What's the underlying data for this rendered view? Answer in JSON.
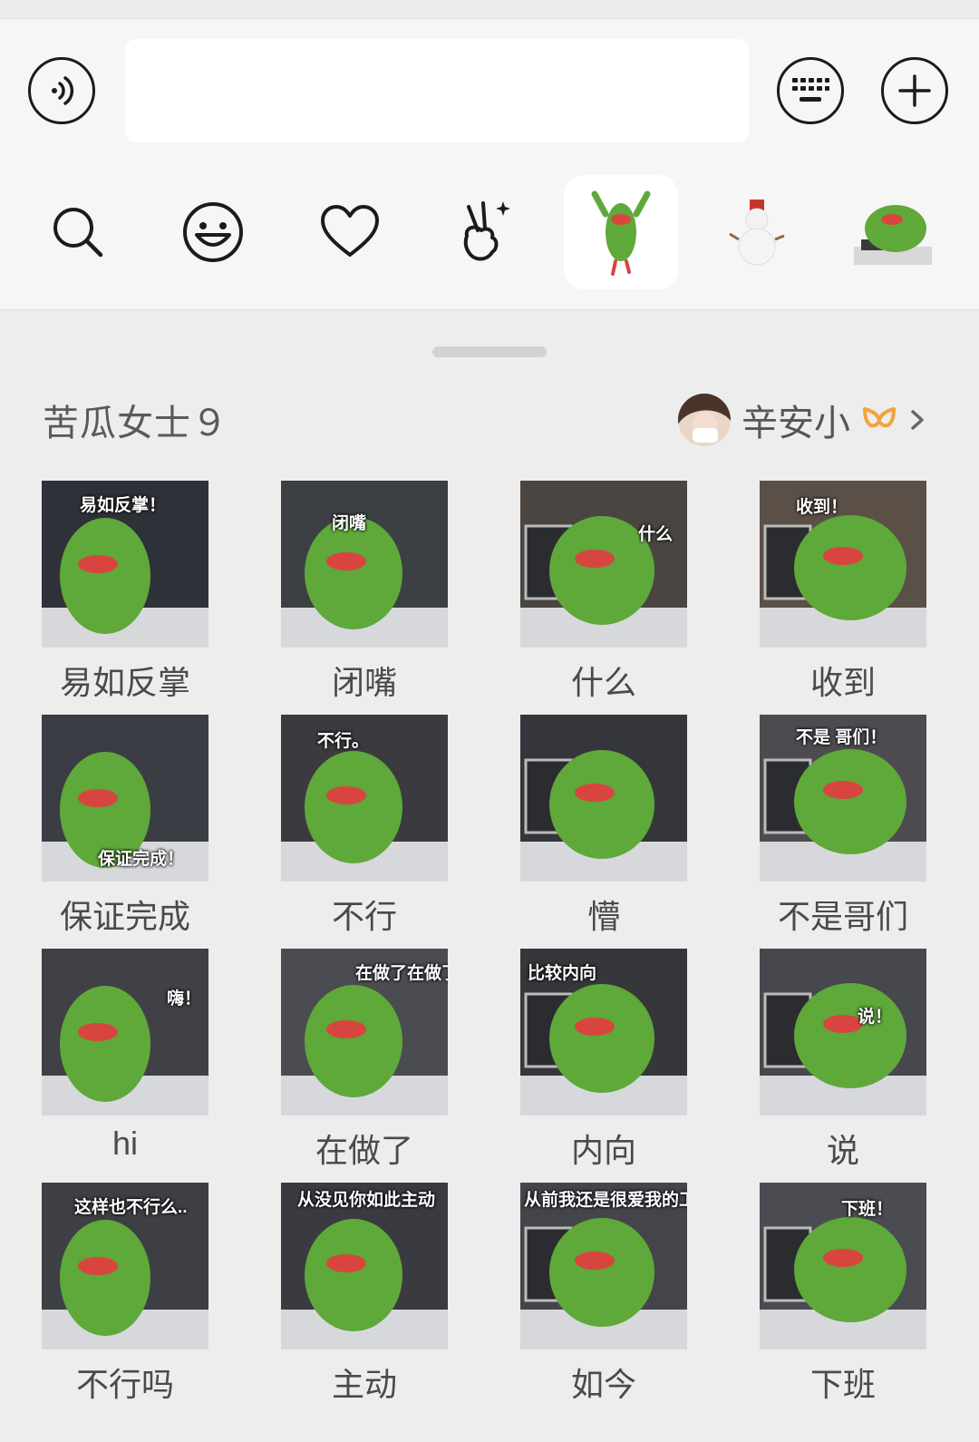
{
  "input_bar": {
    "text_value": ""
  },
  "tabs": [
    "search",
    "emoji",
    "favorites",
    "gesture",
    "pack-bitter-gourd",
    "pack-snowman",
    "pack-bitter-gourd-desk"
  ],
  "pack": {
    "title": "苦瓜女士９",
    "author": "辛安小"
  },
  "stickers": [
    {
      "label": "易如反掌",
      "caption": "易如反掌！",
      "bg": "#2e3138"
    },
    {
      "label": "闭嘴",
      "caption": "闭嘴",
      "bg": "#3c3f44"
    },
    {
      "label": "什么",
      "caption": "什么",
      "bg": "#4a4540"
    },
    {
      "label": "收到",
      "caption": "收到！",
      "bg": "#5b5048"
    },
    {
      "label": "保证完成",
      "caption": "保证完成！",
      "bg": "#3a3d44"
    },
    {
      "label": "不行",
      "caption": "不行。",
      "bg": "#3b3a3e"
    },
    {
      "label": "懵",
      "caption": "",
      "bg": "#35363b"
    },
    {
      "label": "不是哥们",
      "caption": "不是 哥们！",
      "bg": "#4d4b50"
    },
    {
      "label": "hi",
      "caption": "嗨！",
      "bg": "#3f4147"
    },
    {
      "label": "在做了",
      "caption": "在做了在做了",
      "bg": "#4a4c52"
    },
    {
      "label": "内向",
      "caption": "比较内向",
      "bg": "#36373b"
    },
    {
      "label": "说",
      "caption": "说！",
      "bg": "#46484d"
    },
    {
      "label": "不行吗",
      "caption": "这样也不行么..",
      "bg": "#3d3f45"
    },
    {
      "label": "主动",
      "caption": "从没见你如此主动",
      "bg": "#3a3b40"
    },
    {
      "label": "如今",
      "caption": "从前我还是很爱我的工作的 但如今",
      "bg": "#44454b"
    },
    {
      "label": "下班",
      "caption": "下班！",
      "bg": "#4b4c52"
    }
  ],
  "colors": {
    "accent_orange": "#f2a33a",
    "gourd_green": "#5fa83a",
    "lip_red": "#d8453f"
  }
}
